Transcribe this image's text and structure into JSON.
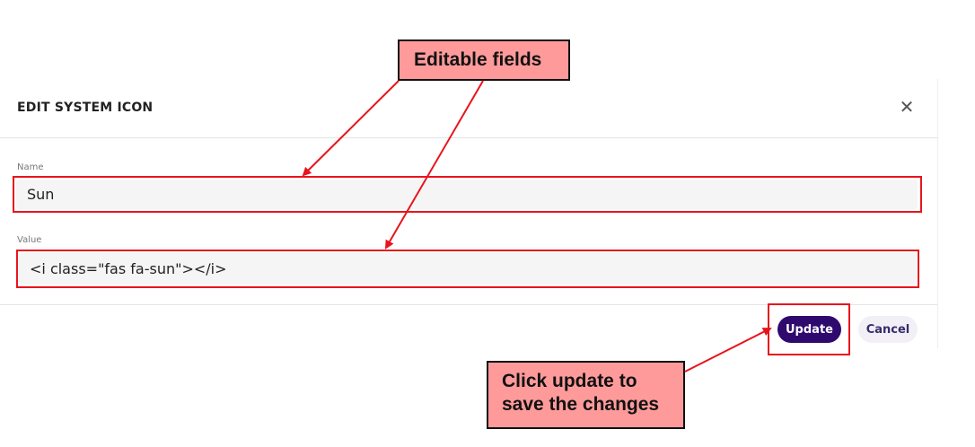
{
  "modal": {
    "title": "EDIT SYSTEM ICON",
    "close_icon": "close-icon",
    "name_label": "Name",
    "name_value": "Sun",
    "value_label": "Value",
    "value_value": "<i class=\"fas fa-sun\"></i>",
    "update_label": "Update",
    "cancel_label": "Cancel"
  },
  "annotations": {
    "editable_fields": "Editable fields",
    "update_hint_line1": "Click update to",
    "update_hint_line2": "save the changes"
  },
  "colors": {
    "annotation_red": "#e8141c",
    "callout_fill": "#ff9a9a",
    "primary_button": "#2e0a6e"
  }
}
